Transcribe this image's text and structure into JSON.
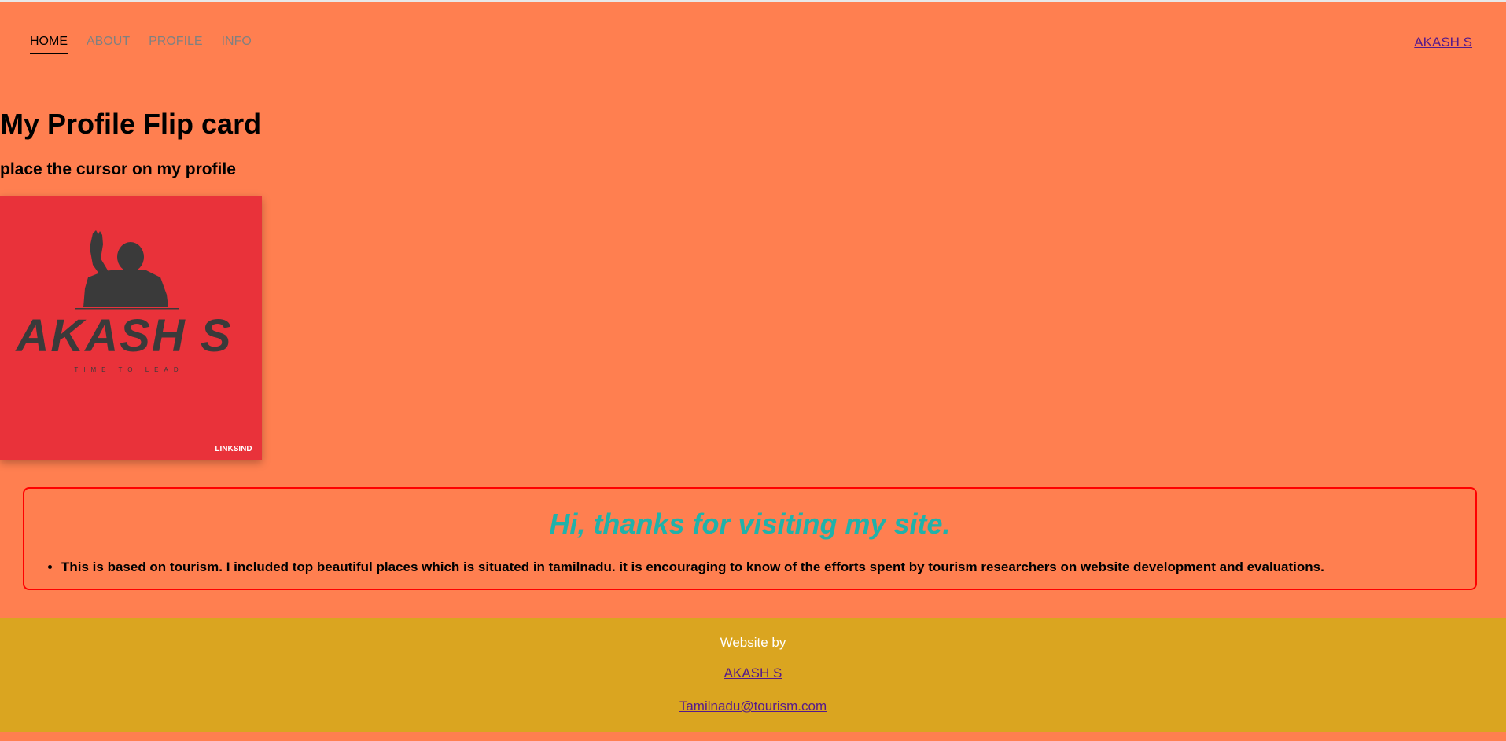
{
  "nav": {
    "items": [
      {
        "label": "HOME",
        "active": true
      },
      {
        "label": "ABOUT",
        "active": false
      },
      {
        "label": "PROFILE",
        "active": false
      },
      {
        "label": "INFO",
        "active": false
      }
    ],
    "brand": "AKASH S"
  },
  "main": {
    "title": "My Profile Flip card",
    "instruction": "place the cursor on my profile",
    "card": {
      "logo_name": "AKASH S",
      "logo_tagline": "TIME TO LEAD",
      "watermark": "LINKSIND"
    }
  },
  "message": {
    "greeting": "Hi, thanks for visiting my site.",
    "items": [
      "This is based on tourism. I included top beautiful places which is situated in tamilnadu. it is encouraging to know of the efforts spent by tourism researchers on website development and evaluations."
    ]
  },
  "footer": {
    "label": "Website by",
    "author": "AKASH S",
    "email": "Tamilnadu@tourism.com"
  },
  "colors": {
    "background": "#ff7f50",
    "card": "#e9323a",
    "greeting": "#20b2aa",
    "footer": "#daa520",
    "border": "#ff0000",
    "link": "#551a8b"
  }
}
